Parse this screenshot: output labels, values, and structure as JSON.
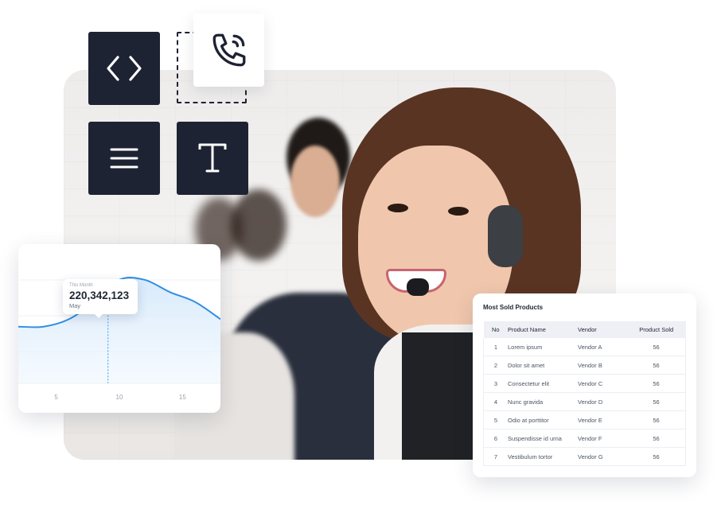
{
  "tools": {
    "code_icon": "code-icon",
    "phone_icon": "phone-call-icon",
    "menu_icon": "menu-lines-icon",
    "text_icon": "text-t-icon"
  },
  "colors": {
    "tile_dark": "#1e2333",
    "chart_line": "#2f8fe4",
    "chart_fill": "#d8eafb"
  },
  "chart_card": {
    "tooltip_label": "This Month",
    "tooltip_value": "220,342,123",
    "tooltip_month": "May"
  },
  "chart_data": {
    "type": "area",
    "x": [
      2,
      4,
      6,
      8,
      10,
      12,
      14,
      16,
      18
    ],
    "values": [
      46,
      46,
      52,
      66,
      84,
      84,
      74,
      66,
      52
    ],
    "highlight_x": 9.1,
    "xticks": [
      "5",
      "10",
      "15"
    ],
    "xtick_values": [
      5,
      10,
      15
    ],
    "xlim": [
      2,
      18
    ],
    "ylim": [
      0,
      100
    ],
    "grid": true
  },
  "products": {
    "title": "Most Sold Products",
    "columns": [
      "No",
      "Product Name",
      "Vendor",
      "Product Sold"
    ],
    "rows": [
      [
        "1",
        "Lorem ipsum",
        "Vendor A",
        "56"
      ],
      [
        "2",
        "Dolor sit amet",
        "Vendor B",
        "56"
      ],
      [
        "3",
        "Consectetur elit",
        "Vendor C",
        "56"
      ],
      [
        "4",
        "Nunc gravida",
        "Vendor D",
        "56"
      ],
      [
        "5",
        "Odio at porttitor",
        "Vendor E",
        "56"
      ],
      [
        "6",
        "Suspendisse id urna",
        "Vendor F",
        "56"
      ],
      [
        "7",
        "Vestibulum tortor",
        "Vendor G",
        "56"
      ]
    ]
  }
}
